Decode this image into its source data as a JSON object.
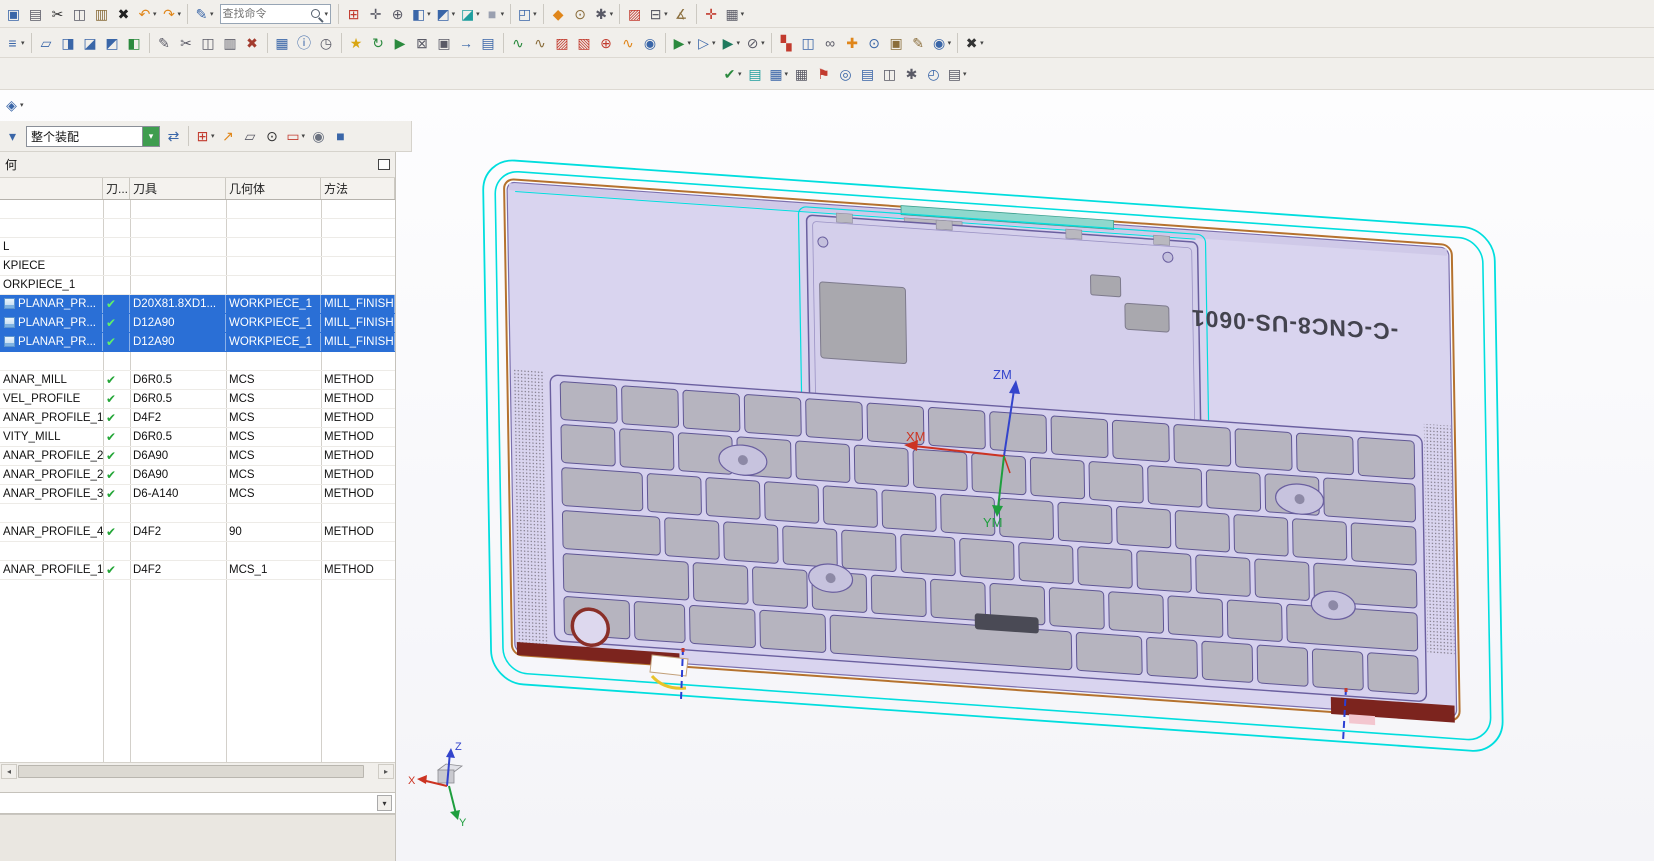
{
  "toolbars": {
    "row1a": [
      {
        "n": "save",
        "g": "▣",
        "c": "#3a66a8"
      },
      {
        "n": "print",
        "g": "▤",
        "c": "#5a5a66"
      },
      {
        "n": "cut",
        "g": "✂",
        "c": "#333333"
      },
      {
        "n": "copy",
        "g": "◫",
        "c": "#5a5a66"
      },
      {
        "n": "paste",
        "g": "▥",
        "c": "#8a6d3b"
      },
      {
        "n": "delete",
        "g": "✖",
        "c": "#222222"
      },
      {
        "n": "undo",
        "g": "↶",
        "c": "#e0861a",
        "dd": true
      },
      {
        "n": "redo",
        "g": "↷",
        "c": "#e0861a",
        "dd": true
      },
      {
        "sep": true
      },
      {
        "n": "sketch-curve",
        "g": "✎",
        "c": "#3a66a8",
        "dd": true
      }
    ],
    "find": {
      "placeholder": "查找命令"
    },
    "row1b": [
      {
        "sep": true
      },
      {
        "n": "fit-view",
        "g": "⊞",
        "c": "#c23b2e"
      },
      {
        "n": "pan",
        "g": "✛",
        "c": "#5a5a66"
      },
      {
        "n": "zoom",
        "g": "⊕",
        "c": "#5a5a66"
      },
      {
        "n": "front-view",
        "g": "◧",
        "c": "#3a66a8",
        "dd": true
      },
      {
        "n": "isometric-view",
        "g": "◩",
        "c": "#3a66a8",
        "dd": true
      },
      {
        "n": "trimetric-view",
        "g": "◪",
        "c": "#1f9e9e",
        "dd": true
      },
      {
        "n": "shaded-display",
        "g": "■",
        "c": "#9aa0b0",
        "dd": true
      },
      {
        "sep": true
      },
      {
        "n": "window",
        "g": "◰",
        "c": "#3a66a8",
        "dd": true
      },
      {
        "sep": true
      },
      {
        "n": "move-rotate",
        "g": "◆",
        "c": "#e0861a"
      },
      {
        "n": "snap-point",
        "g": "⊙",
        "c": "#8a6d3b"
      },
      {
        "n": "assembly-constraints",
        "g": "✱",
        "c": "#5a5a66",
        "dd": true
      },
      {
        "sep": true
      },
      {
        "n": "edit-section",
        "g": "▨",
        "c": "#c23b2e"
      },
      {
        "n": "datum-plane",
        "g": "⊟",
        "c": "#5a5a66",
        "dd": true
      },
      {
        "n": "measure",
        "g": "∡",
        "c": "#8a6d3b"
      },
      {
        "sep": true
      },
      {
        "n": "wcs-display",
        "g": "✛",
        "c": "#c23b2e"
      },
      {
        "n": "grid",
        "g": "▦",
        "c": "#5a5a66",
        "dd": true
      }
    ],
    "row2": [
      {
        "n": "menu",
        "g": "≡",
        "c": "#3a66a8",
        "dd": true
      },
      {
        "sep": true
      },
      {
        "n": "create-program",
        "g": "▱",
        "c": "#3a66a8"
      },
      {
        "n": "create-tool",
        "g": "◨",
        "c": "#3a66a8"
      },
      {
        "n": "create-geometry",
        "g": "◪",
        "c": "#3a66a8"
      },
      {
        "n": "create-method",
        "g": "◩",
        "c": "#3a66a8"
      },
      {
        "n": "create-operation",
        "g": "◧",
        "c": "#2b8a3e"
      },
      {
        "sep": true
      },
      {
        "n": "edit-object",
        "g": "✎",
        "c": "#5a5a66"
      },
      {
        "n": "cut-object",
        "g": "✂",
        "c": "#5a5a66"
      },
      {
        "n": "copy-object",
        "g": "◫",
        "c": "#5a5a66"
      },
      {
        "n": "paste-object",
        "g": "▥",
        "c": "#5a5a66"
      },
      {
        "n": "delete-object",
        "g": "✖",
        "c": "#a33b2e"
      },
      {
        "sep": true
      },
      {
        "n": "show-toolpath",
        "g": "▦",
        "c": "#3a66a8"
      },
      {
        "n": "object-info",
        "g": "ⓘ",
        "c": "#3a66a8"
      },
      {
        "n": "clock",
        "g": "◷",
        "c": "#5a5a66"
      },
      {
        "sep": true
      },
      {
        "n": "generate-toolpath",
        "g": "★",
        "c": "#d9a511"
      },
      {
        "n": "replay-toolpath",
        "g": "↻",
        "c": "#2b8a3e"
      },
      {
        "n": "verify-toolpath",
        "g": "▶",
        "c": "#2b8a3e"
      },
      {
        "n": "gouge-check",
        "g": "⊠",
        "c": "#5a5a66"
      },
      {
        "n": "machine-simulation",
        "g": "▣",
        "c": "#5a5a66"
      },
      {
        "n": "postprocess",
        "g": "→",
        "c": "#3a66a8"
      },
      {
        "n": "shop-documentation",
        "g": "▤",
        "c": "#3a66a8"
      },
      {
        "sep": true
      },
      {
        "n": "tool-axis",
        "g": "∿",
        "c": "#2b8a3e"
      },
      {
        "n": "projection-vector",
        "g": "∿",
        "c": "#8a6d3b"
      },
      {
        "n": "section-curves",
        "g": "▨",
        "c": "#c23b2e"
      },
      {
        "n": "section-view",
        "g": "▧",
        "c": "#c23b2e"
      },
      {
        "n": "point-target",
        "g": "⊕",
        "c": "#c23b2e"
      },
      {
        "n": "spline-curve",
        "g": "∿",
        "c": "#e0861a"
      },
      {
        "n": "feeds-speeds",
        "g": "◉",
        "c": "#3a66a8"
      },
      {
        "sep": true
      },
      {
        "n": "play-forward",
        "g": "▶",
        "c": "#2b8a3e",
        "dd": true
      },
      {
        "n": "step-forward",
        "g": "▷",
        "c": "#3a66a8",
        "dd": true
      },
      {
        "n": "simulate-play",
        "g": "▶",
        "c": "#1f7a5e",
        "dd": true
      },
      {
        "n": "turning-tool",
        "g": "⊘",
        "c": "#5a5a66",
        "dd": true
      },
      {
        "sep": true
      },
      {
        "n": "toolpath-report",
        "g": "▚",
        "c": "#c23b2e"
      },
      {
        "n": "tool-list",
        "g": "◫",
        "c": "#3a66a8"
      },
      {
        "n": "compare",
        "g": "∞",
        "c": "#5a5a66"
      },
      {
        "n": "add-to-list",
        "g": "✚",
        "c": "#e0861a"
      },
      {
        "n": "find-object",
        "g": "⊙",
        "c": "#3a66a8"
      },
      {
        "n": "stamp",
        "g": "▣",
        "c": "#8a6d3b"
      },
      {
        "n": "edit-note",
        "g": "✎",
        "c": "#8a6d3b"
      },
      {
        "n": "ball-tool",
        "g": "◉",
        "c": "#3a66a8",
        "dd": true
      },
      {
        "sep": true
      },
      {
        "n": "close",
        "g": "✖",
        "c": "#333333",
        "dd": true
      }
    ],
    "row3": [
      {
        "n": "verify-all",
        "g": "✔",
        "c": "#2b8a3e",
        "dd": true
      },
      {
        "n": "edit-display",
        "g": "▤",
        "c": "#1f9e9e"
      },
      {
        "n": "operation-list",
        "g": "▦",
        "c": "#3a66a8",
        "dd": true
      },
      {
        "n": "worksheet",
        "g": "▦",
        "c": "#5a5a66"
      },
      {
        "n": "flag",
        "g": "⚑",
        "c": "#c23b2e"
      },
      {
        "n": "find-in-navigator",
        "g": "◎",
        "c": "#3a66a8"
      },
      {
        "n": "information",
        "g": "▤",
        "c": "#3a66a8"
      },
      {
        "n": "copy-display",
        "g": "◫",
        "c": "#5a5a66"
      },
      {
        "n": "customize",
        "g": "✱",
        "c": "#5a5a66"
      },
      {
        "n": "history",
        "g": "◴",
        "c": "#3a66a8"
      },
      {
        "n": "options",
        "g": "▤",
        "c": "#5a5a66",
        "dd": true
      }
    ],
    "mini": [
      {
        "n": "panel-options",
        "g": "◈",
        "c": "#3a66a8",
        "dd": true
      }
    ],
    "sel_menu": [
      {
        "n": "selection-bar-options",
        "g": "▾",
        "c": "#3a66a8"
      }
    ],
    "selection": [
      {
        "n": "reset-filter",
        "g": "⇄",
        "c": "#3a66a8"
      },
      {
        "sep": true
      },
      {
        "n": "point-constructor",
        "g": "⊞",
        "c": "#c23b2e",
        "dd": true
      },
      {
        "n": "vector-constructor",
        "g": "↗",
        "c": "#e0861a"
      },
      {
        "n": "plane-constructor",
        "g": "▱",
        "c": "#5a5a66"
      },
      {
        "n": "snap-center",
        "g": "⊙",
        "c": "#333333"
      },
      {
        "n": "rectangle-select",
        "g": "▭",
        "c": "#c23b2e",
        "dd": true
      },
      {
        "n": "general-filter",
        "g": "◉",
        "c": "#6b7280"
      },
      {
        "n": "body-filter",
        "g": "■",
        "c": "#3a66a8"
      }
    ]
  },
  "selection_scope": {
    "value": "整个装配"
  },
  "navigator": {
    "title": "何",
    "columns": {
      "name": "",
      "check": "刀...",
      "tool": "刀具",
      "geom": "几何体",
      "method": "方法"
    },
    "rows": [
      {
        "name": "",
        "check": false,
        "tool": "",
        "geom": "",
        "method": "",
        "sel": false,
        "icon": false
      },
      {
        "name": "",
        "check": false,
        "tool": "",
        "geom": "",
        "method": "",
        "sel": false,
        "icon": false
      },
      {
        "name": "L",
        "check": false,
        "tool": "",
        "geom": "",
        "method": "",
        "sel": false,
        "icon": false
      },
      {
        "name": "KPIECE",
        "check": false,
        "tool": "",
        "geom": "",
        "method": "",
        "sel": false,
        "icon": false
      },
      {
        "name": "ORKPIECE_1",
        "check": false,
        "tool": "",
        "geom": "",
        "method": "",
        "sel": false,
        "icon": false
      },
      {
        "name": "PLANAR_PR...",
        "check": true,
        "tool": "D20X81.8XD1...",
        "geom": "WORKPIECE_1",
        "method": "MILL_FINISH",
        "sel": true,
        "icon": true
      },
      {
        "name": "PLANAR_PR...",
        "check": true,
        "tool": "D12A90",
        "geom": "WORKPIECE_1",
        "method": "MILL_FINISH",
        "sel": true,
        "icon": true
      },
      {
        "name": "PLANAR_PR...",
        "check": true,
        "tool": "D12A90",
        "geom": "WORKPIECE_1",
        "method": "MILL_FINISH",
        "sel": true,
        "icon": true
      },
      {
        "name": "",
        "check": false,
        "tool": "",
        "geom": "",
        "method": "",
        "sel": false,
        "icon": false
      },
      {
        "name": "ANAR_MILL",
        "check": true,
        "tool": "D6R0.5",
        "geom": "MCS",
        "method": "METHOD",
        "sel": false,
        "icon": false
      },
      {
        "name": "VEL_PROFILE",
        "check": true,
        "tool": "D6R0.5",
        "geom": "MCS",
        "method": "METHOD",
        "sel": false,
        "icon": false
      },
      {
        "name": "ANAR_PROFILE_1",
        "check": true,
        "tool": "D4F2",
        "geom": "MCS",
        "method": "METHOD",
        "sel": false,
        "icon": false
      },
      {
        "name": "VITY_MILL",
        "check": true,
        "tool": "D6R0.5",
        "geom": "MCS",
        "method": "METHOD",
        "sel": false,
        "icon": false
      },
      {
        "name": "ANAR_PROFILE_2",
        "check": true,
        "tool": "D6A90",
        "geom": "MCS",
        "method": "METHOD",
        "sel": false,
        "icon": false
      },
      {
        "name": "ANAR_PROFILE_2...",
        "check": true,
        "tool": "D6A90",
        "geom": "MCS",
        "method": "METHOD",
        "sel": false,
        "icon": false
      },
      {
        "name": "ANAR_PROFILE_3",
        "check": true,
        "tool": "D6-A140",
        "geom": "MCS",
        "method": "METHOD",
        "sel": false,
        "icon": false
      },
      {
        "name": "",
        "check": false,
        "tool": "",
        "geom": "",
        "method": "",
        "sel": false,
        "icon": false
      },
      {
        "name": "ANAR_PROFILE_4",
        "check": true,
        "tool": "D4F2",
        "geom": "90",
        "method": "METHOD",
        "sel": false,
        "icon": false
      },
      {
        "name": "",
        "check": false,
        "tool": "",
        "geom": "",
        "method": "",
        "sel": false,
        "icon": false
      },
      {
        "name": "ANAR_PROFILE_1...",
        "check": true,
        "tool": "D4F2",
        "geom": "MCS_1",
        "method": "METHOD",
        "sel": false,
        "icon": false
      }
    ]
  },
  "viewport": {
    "engraving": "-C-CNC8-US-0601",
    "wcs_labels": {
      "z": "ZM",
      "x": "XM",
      "y": "YM"
    },
    "triad_labels": {
      "z": "Z",
      "x": "X",
      "y": "Y"
    }
  },
  "colors": {
    "selection": "#2a6fd6",
    "check_green": "#23a637",
    "toolpath_cyan": "#00dede",
    "deck_lavender": "#d9d4ef",
    "stock_orange": "#b5722e"
  }
}
